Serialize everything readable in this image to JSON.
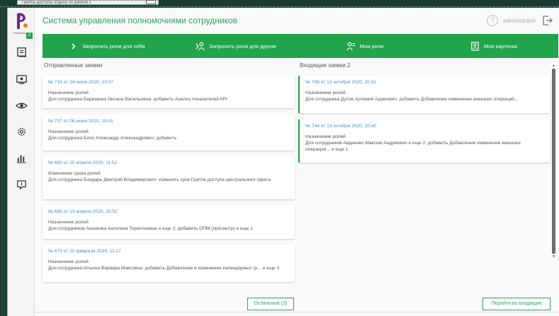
{
  "background": {
    "window_tab_title": "Группа доступа отдела по работе с"
  },
  "sidebar": {
    "logo_text": "Ростелеком",
    "badge_count": "2",
    "items": [
      {
        "icon": "requests-icon"
      },
      {
        "icon": "monitor-icon"
      },
      {
        "icon": "eye-icon"
      },
      {
        "icon": "gear-icon"
      },
      {
        "icon": "chart-icon"
      },
      {
        "icon": "book-icon"
      }
    ]
  },
  "header": {
    "title": "Система управления полномочиями сотрудников",
    "help_symbol": "?",
    "user_name": "administrator"
  },
  "actionbar": {
    "items": [
      {
        "label": "Запросить роли для себя",
        "icon": "chevron-right-icon"
      },
      {
        "label": "Запросить роли для других",
        "icon": "user-arrow-icon"
      },
      {
        "label": "Мои роли",
        "icon": "user-list-icon"
      },
      {
        "label": "Моя карточка",
        "icon": "id-card-icon"
      }
    ]
  },
  "sent": {
    "title": "Отправленные заявки",
    "cards": [
      {
        "link": "№ 715 от 24 июля 2020, 13:07",
        "type": "Назначение ролей",
        "desc": "Для сотрудника Березкина Оксана Васильевна: добавить Анализ показателей КРІ"
      },
      {
        "link": "№ 707 от 08 июня 2020, 15:01",
        "type": "Назначение ролей",
        "desc": "Для сотрудника Блох Александр Александрович: добавить"
      },
      {
        "link": "№ 690 от 20 апреля 2020, 11:52",
        "type": "Изменение срока ролей",
        "desc": "Для сотрудника Бондарь Дмитрий Владимирович: изменить срок Группа доступа центрального офиса"
      },
      {
        "link": "№ 685 от 13 апреля 2020, 15:52",
        "type": "Назначение ролей",
        "desc": "Для сотрудников Аксенова Ангелина Терентьевна и еще 2: добавить ОПМ (просмотр) и еще 1"
      },
      {
        "link": "№ 673 от 10 февраля 2020, 11:17",
        "type": "Назначение ролей",
        "desc": "Для сотрудника Ильина Варвара Максовна: добавить Добавление и изменение календарных гр... и еще 3"
      }
    ],
    "more_button": "Остальные (3)"
  },
  "incoming": {
    "title": "Входящие заявки 2",
    "cards": [
      {
        "link": "№ 745 от 13 октября 2020, 20:41",
        "type": "Назначение ролей",
        "desc": "Для сотрудника Дутов Артемий Адамович: добавить Добавление изменение внешних операций..."
      },
      {
        "link": "№ 744 от 13 октября 2020, 20:40",
        "type": "Назначение ролей",
        "desc": "Для сотрудников Авдеенко Максим Андреевич и еще 2: добавить Добавление изменение внешних операций... и еще 1"
      }
    ],
    "goto_button": "Перейти во входящие"
  },
  "colors": {
    "accent": "#21a44a",
    "title": "#2aa457",
    "link": "#3a8ed6"
  }
}
